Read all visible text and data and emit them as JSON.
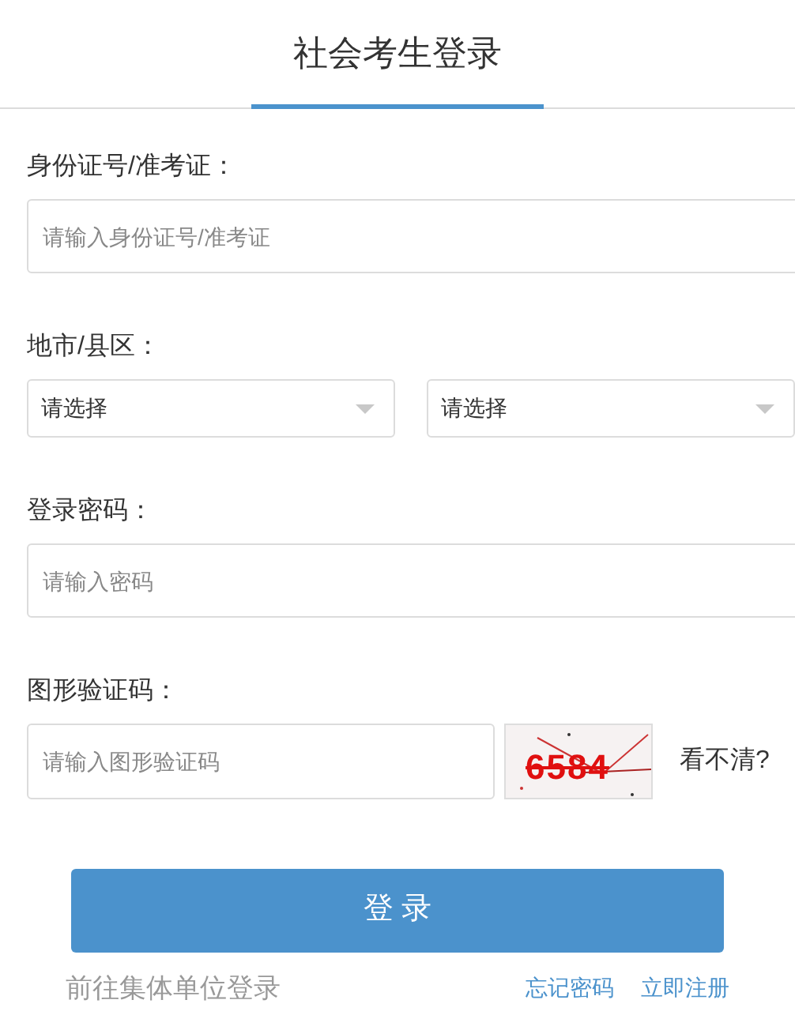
{
  "tabs": [
    {
      "label": "社会考生登录",
      "selected": true
    }
  ],
  "fields": [
    {
      "kind": "input",
      "label": "身份证号/准考证：",
      "placeholder": "请输入身份证号/准考证"
    },
    {
      "kind": "selects",
      "label": "地市/县区：",
      "selects": [
        {
          "value": "请选择"
        },
        {
          "value": "请选择"
        }
      ]
    },
    {
      "kind": "input",
      "label": "登录密码：",
      "placeholder": "请输入密码"
    },
    {
      "kind": "captcha",
      "label": "图形验证码：",
      "placeholder": "请输入图形验证码",
      "captcha_text": "6584",
      "refresh": "看不清?"
    }
  ],
  "login_button": "登 录",
  "links": {
    "group_login": "前往集体单位登录",
    "forgot": "忘记密码",
    "register": "立即注册"
  }
}
